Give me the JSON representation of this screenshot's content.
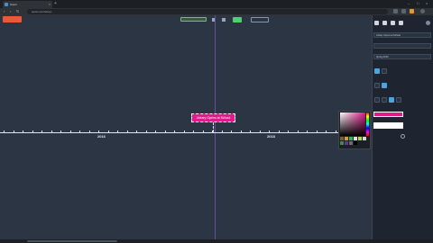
{
  "browser": {
    "tab_title": "Sutori",
    "new_tab": "+",
    "url": "sutori.com/story/...",
    "nav_back": "‹",
    "nav_forward": "›",
    "nav_reload": "↻",
    "min": "–",
    "max": "□",
    "close": "×"
  },
  "toolbar": {
    "red_button_label": "",
    "green_chip_label": "",
    "ghost_button_label": ""
  },
  "timeline": {
    "event_label": "Library Opens at School",
    "years": [
      "2016",
      "2018"
    ]
  },
  "panel": {
    "title_value": "Library Opens at School",
    "field2_value": "",
    "field3_value": "Spring 2016",
    "color_label": "",
    "color_value": ""
  },
  "colors": {
    "accent": "#e01b8c",
    "background": "#2b3544",
    "panel": "#1e2530",
    "playhead": "#6a4c9c"
  }
}
